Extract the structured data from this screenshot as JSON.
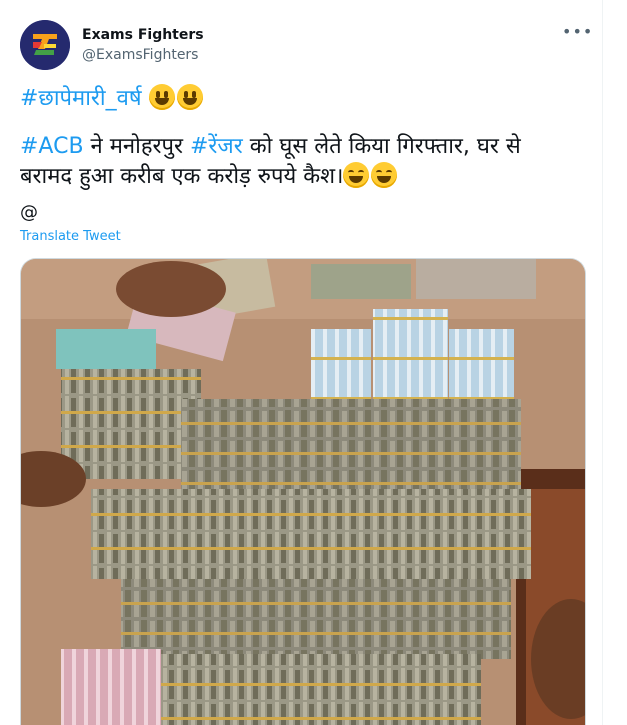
{
  "author": {
    "display_name": "Exams Fighters",
    "handle": "@ExamsFighters",
    "avatar_icon": "exams-fighters-logo"
  },
  "more_icon": "ellipsis-icon",
  "tweet": {
    "line1_hashtag": "#छापेमारी_वर्ष",
    "line2_hashtag_acb": "#ACB",
    "line2_text_a": " ने मनोहरपुर ",
    "line2_hashtag_ranger": "#रेंजर",
    "line2_text_b": " को घूस लेते किया गिरफ्तार, घर से",
    "line3_text": "बरामद हुआ करीब एक करोड़ रुपये कैश।",
    "at_line": "@"
  },
  "translate_label": "Translate Tweet",
  "colors": {
    "link": "#1d9bf0",
    "text": "#0f1419",
    "secondary": "#536471"
  },
  "media": {
    "icon": "photo-cash-bundles"
  }
}
